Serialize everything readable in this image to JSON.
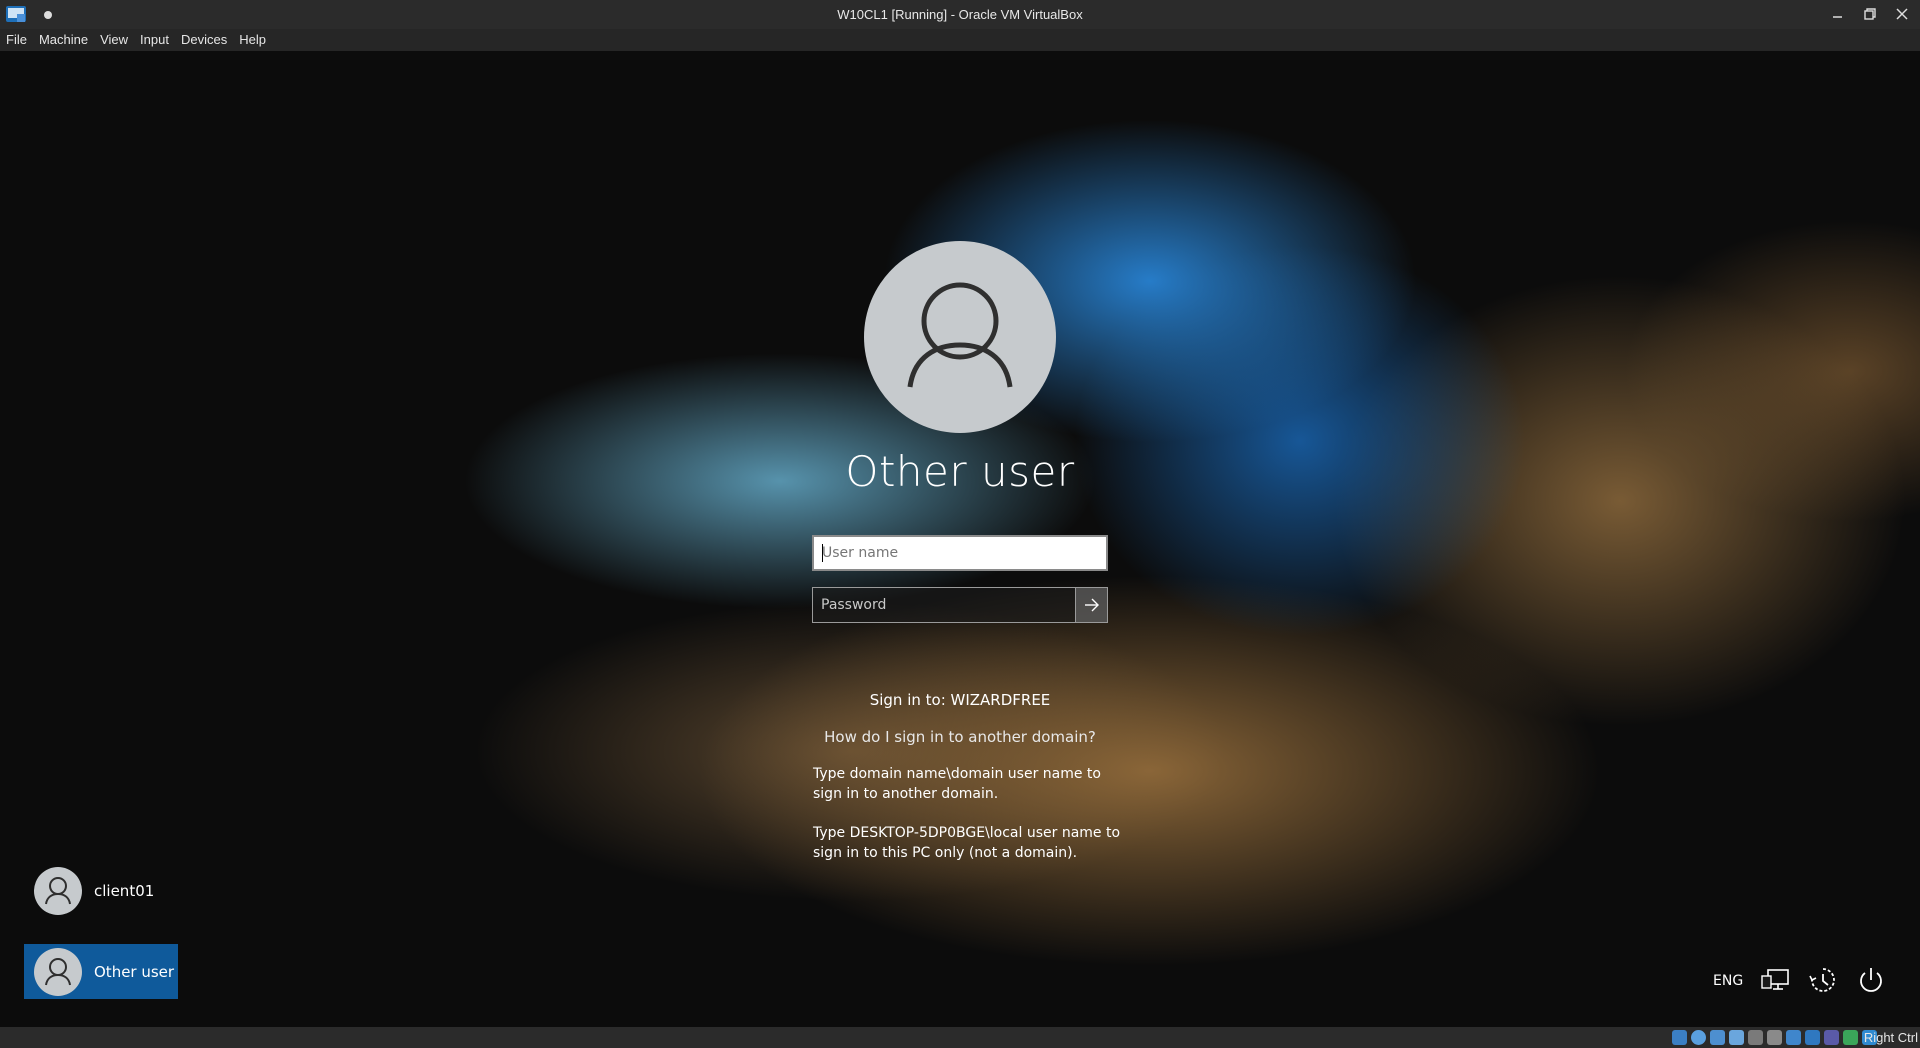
{
  "window": {
    "title": "W10CL1 [Running] - Oracle VM VirtualBox"
  },
  "menubar": {
    "items": [
      "File",
      "Machine",
      "View",
      "Input",
      "Devices",
      "Help"
    ]
  },
  "login": {
    "user_title": "Other user",
    "username_placeholder": "User name",
    "password_placeholder": "Password",
    "sign_in_to": "Sign in to: WIZARDFREE",
    "other_domain_link": "How do I sign in to another domain?",
    "hint_domain": "Type domain name\\domain user name to sign in to another domain.",
    "hint_local": "Type DESKTOP-5DP0BGE\\local user name to sign in to this PC only (not a domain)."
  },
  "user_list": {
    "items": [
      {
        "label": "client01",
        "selected": false
      },
      {
        "label": "Other user",
        "selected": true
      }
    ]
  },
  "system_tray": {
    "language": "ENG",
    "icons": [
      "network-icon",
      "ease-of-access-icon",
      "power-icon"
    ]
  },
  "statusbar": {
    "host_key": "Right Ctrl",
    "icons": [
      "hard-disk-icon",
      "optical-drive-icon",
      "audio-icon",
      "network-adapter-icon",
      "usb-icon",
      "shared-folders-icon",
      "display-icon",
      "recording-icon",
      "virtualization-icon",
      "mouse-integration-icon",
      "keyboard-icon"
    ]
  },
  "colors": {
    "selected_tile": "#0f5a9b",
    "avatar_bg": "#c6cacd"
  }
}
